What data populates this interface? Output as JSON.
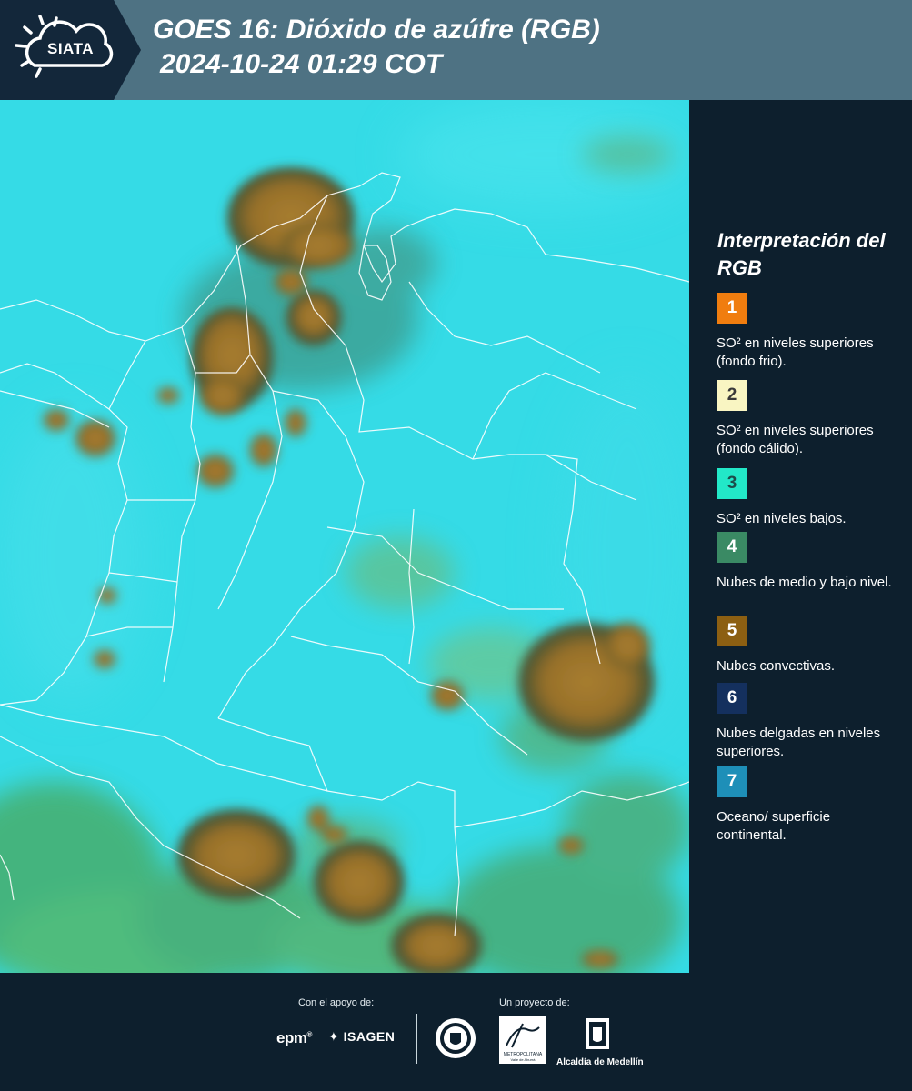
{
  "header": {
    "logo_text": "SIATA",
    "title_line1": "GOES 16: Dióxido de azúfre (RGB)",
    "title_line2": "2024-10-24 01:29 COT"
  },
  "legend": {
    "title": "Interpretación del RGB",
    "items": [
      {
        "number": "1",
        "color": "#f07d0f",
        "text_color": "#ffffff",
        "label": "SO² en niveles superiores (fondo frio)."
      },
      {
        "number": "2",
        "color": "#f9f5c2",
        "text_color": "#3a3a3a",
        "label": "SO² en niveles superiores (fondo cálido)."
      },
      {
        "number": "3",
        "color": "#22e8c8",
        "text_color": "#1d4d4a",
        "label": "SO² en niveles bajos."
      },
      {
        "number": "4",
        "color": "#3a8a64",
        "text_color": "#ffffff",
        "label": "Nubes de medio y bajo nivel."
      },
      {
        "number": "5",
        "color": "#8c5f12",
        "text_color": "#ffffff",
        "label": "Nubes convectivas."
      },
      {
        "number": "6",
        "color": "#14305e",
        "text_color": "#ffffff",
        "label": "Nubes delgadas en niveles superiores."
      },
      {
        "number": "7",
        "color": "#1e8fb8",
        "text_color": "#ffffff",
        "label": "Oceano/ superficie continental."
      }
    ]
  },
  "footer": {
    "support_label": "Con el apoyo de:",
    "project_label": "Un proyecto de:",
    "epm": "epm",
    "isagen": "ISAGEN",
    "area_label": "METROPOLITANA",
    "area_sub": "Valle de Aburrá",
    "alcaldia": "Alcaldía de Medellín"
  }
}
